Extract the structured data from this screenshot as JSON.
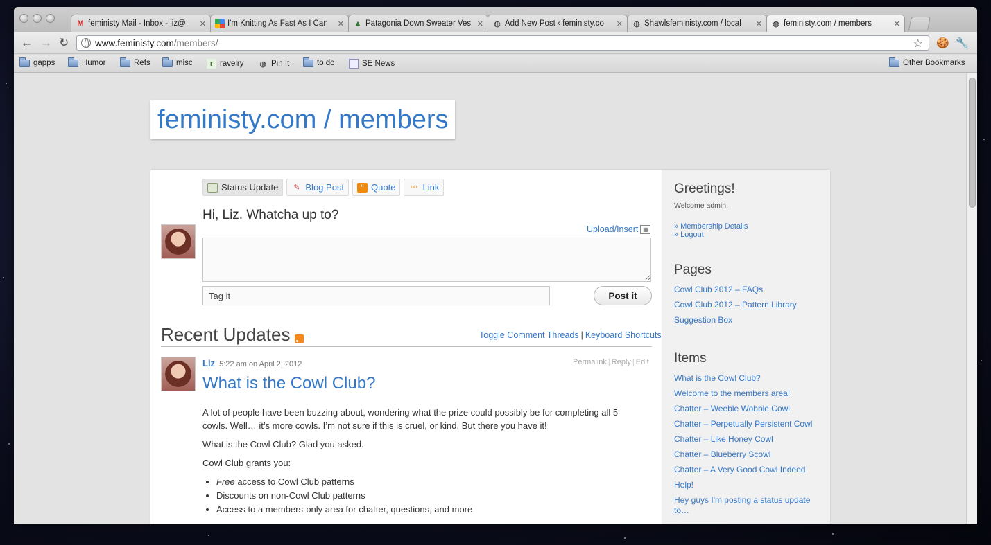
{
  "browser": {
    "tabs": [
      {
        "title": "feministy Mail - Inbox - liz@",
        "icon": "gmail-icon"
      },
      {
        "title": "I'm Knitting As Fast As I Can",
        "icon": "google-icon"
      },
      {
        "title": "Patagonia Down Sweater Ves",
        "icon": "tree-icon"
      },
      {
        "title": "Add New Post ‹ feministy.co",
        "icon": "globe-icon"
      },
      {
        "title": "Shawlsfeministy.com / local",
        "icon": "globe-icon"
      },
      {
        "title": "feministy.com / members",
        "icon": "globe-icon"
      }
    ],
    "url_host": "www.feministy.com",
    "url_path": "/members/",
    "bookmarks": [
      "gapps",
      "Humor",
      "Refs",
      "misc",
      "ravelry",
      "Pin It",
      "to do",
      "SE News"
    ],
    "other_bookmarks": "Other Bookmarks"
  },
  "site": {
    "title": "feministy.com / members"
  },
  "composer": {
    "tabs": [
      "Status Update",
      "Blog Post",
      "Quote",
      "Link"
    ],
    "greeting": "Hi, Liz. Whatcha up to?",
    "upload_label": "Upload/Insert",
    "tag_placeholder": "Tag it",
    "post_button": "Post it"
  },
  "recent": {
    "heading": "Recent Updates",
    "toggle_comments": "Toggle Comment Threads",
    "keyboard_shortcuts": "Keyboard Shortcuts",
    "post": {
      "author": "Liz",
      "time": "5:22 am on April 2, 2012",
      "actions": [
        "Permalink",
        "Reply",
        "Edit"
      ],
      "title": "What is the Cowl Club?",
      "para1": "A lot of people have been buzzing about, wondering what the prize could possibly be for completing all 5 cowls. Well… it’s more cowls. I’m not sure if this is cruel, or kind. But there you have it!",
      "para2": "What is the Cowl Club? Glad you asked.",
      "para3": "Cowl Club grants you:",
      "bullet1_em": "Free",
      "bullet1_rest": " access to Cowl Club patterns",
      "bullet2": "Discounts on non-Cowl Club patterns",
      "bullet3": "Access to a members-only area for chatter, questions, and more"
    }
  },
  "sidebar": {
    "greetings_heading": "Greetings!",
    "welcome": "Welcome admin,",
    "membership_link": "» Membership Details",
    "logout_link": "» Logout",
    "pages_heading": "Pages",
    "pages": [
      "Cowl Club 2012 – FAQs",
      "Cowl Club 2012 – Pattern Library",
      "Suggestion Box"
    ],
    "items_heading": "Items",
    "items": [
      "What is the Cowl Club?",
      "Welcome to the members area!",
      "Chatter – Weeble Wobble Cowl",
      "Chatter – Perpetually Persistent Cowl",
      "Chatter – Like Honey Cowl",
      "Chatter – Blueberry Scowl",
      "Chatter – A Very Good Cowl Indeed",
      "Help!",
      "Hey guys I'm posting a status update",
      "to…"
    ]
  },
  "colors": {
    "link_blue": "#3478c8",
    "rss_orange": "#f3891e",
    "quote_orange": "#f08a0c"
  }
}
